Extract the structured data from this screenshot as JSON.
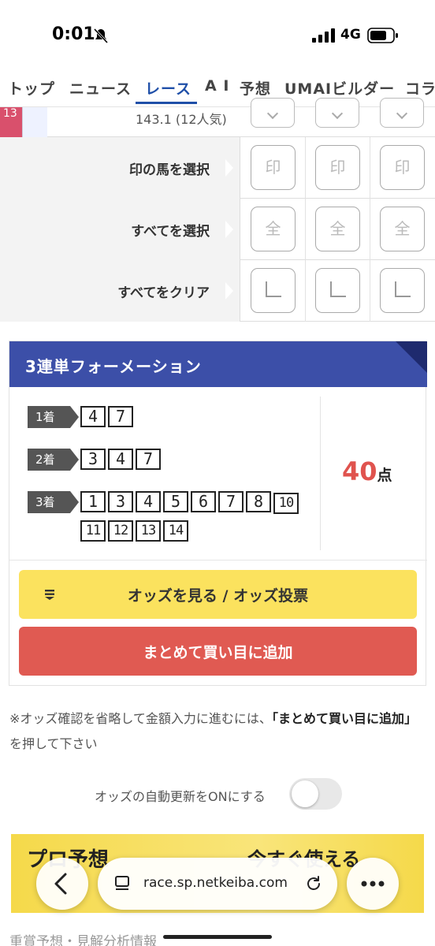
{
  "status_bar": {
    "time": "0:01",
    "network": "4G"
  },
  "nav": {
    "tabs": [
      "トップ",
      "ニュース",
      "レース",
      "A I",
      "予想",
      "UMAIビルダー",
      "コラ"
    ],
    "active_index": 2
  },
  "top_row": {
    "horse_number": "13",
    "odds_text": "143.1 (12人気)"
  },
  "selection_rows": [
    {
      "label": "印の馬を選択",
      "button_glyph": "印"
    },
    {
      "label": "すべてを選択",
      "button_glyph": "全"
    },
    {
      "label": "すべてをクリア",
      "button_glyph": ""
    }
  ],
  "formation": {
    "title": "3連単フォーメーション",
    "places": [
      {
        "label": "1着",
        "numbers": [
          "4",
          "7"
        ]
      },
      {
        "label": "2着",
        "numbers": [
          "3",
          "4",
          "7"
        ]
      },
      {
        "label": "3着",
        "numbers": [
          "1",
          "3",
          "4",
          "5",
          "6",
          "7",
          "8",
          "10",
          "11",
          "12",
          "13",
          "14"
        ]
      }
    ],
    "total_count": "40",
    "total_unit": "点",
    "odds_button": "オッズを見る / オッズ投票",
    "add_button": "まとめて買い目に追加"
  },
  "note": {
    "prefix": "※オッズ確認を省略して金額入力に進むには、",
    "emphasis": "「まとめて買い目に追加」",
    "suffix": "を押して下さい"
  },
  "auto_update": {
    "label": "オッズの自動更新をONにする",
    "enabled": false
  },
  "banner": {
    "left_text": "プロ予想",
    "right_text": "今すぐ使える"
  },
  "browser": {
    "url": "race.sp.netkeiba.com"
  },
  "bottom_partial": "重賞予想・見解分析情報",
  "colors": {
    "nav_active": "#1f4fa8",
    "header_blue": "#3c4fa8",
    "odds_yellow": "#fbe25e",
    "add_red": "#e05a52",
    "count_red": "#e0534e"
  }
}
